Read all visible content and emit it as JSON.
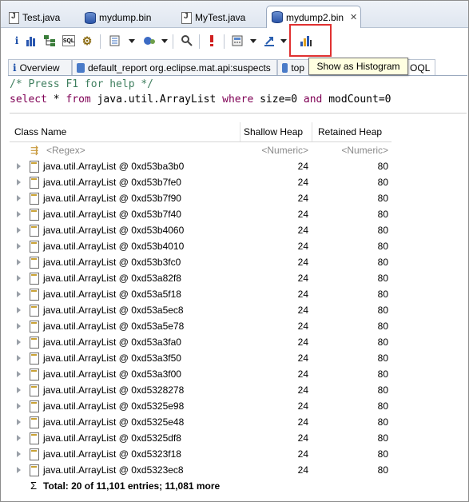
{
  "editor_tabs": [
    {
      "label": "Test.java",
      "icon": "java-file-icon",
      "active": false
    },
    {
      "label": "mydump.bin",
      "icon": "heap-dump-icon",
      "active": false
    },
    {
      "label": "MyTest.java",
      "icon": "java-file-icon",
      "active": false
    },
    {
      "label": "mydump2.bin",
      "icon": "heap-dump-icon",
      "active": true
    }
  ],
  "toolbar": {
    "icons": [
      "info-icon",
      "histogram-icon",
      "dominator-tree-icon",
      "oql-icon",
      "thread-overview-icon",
      "query-browser-icon",
      "find-object-icon",
      "search-icon",
      "run-query-icon",
      "calculate-heap-icon",
      "export-icon",
      "show-as-histogram-icon"
    ],
    "tooltip": "Show as Histogram",
    "highlight_color": "#e03030"
  },
  "sub_tabs": [
    {
      "label": "Overview",
      "icon": "info-icon"
    },
    {
      "label": "default_report  org.eclipse.mat.api:suspects",
      "icon": "report-icon"
    },
    {
      "label": "top",
      "icon": "report-icon"
    },
    {
      "label": "OQL",
      "icon": "oql-icon"
    }
  ],
  "query": {
    "comment": "/* Press F1 for help */",
    "kw_select": "select",
    "p1": " * ",
    "kw_from": "from",
    "p2": " java.util.ArrayList ",
    "kw_where": "where",
    "p3": " size=0 ",
    "kw_and": "and",
    "p4": " modCount=0"
  },
  "table": {
    "columns": [
      "Class Name",
      "Shallow Heap",
      "Retained Heap"
    ],
    "filter": {
      "name": "<Regex>",
      "shallow": "<Numeric>",
      "retained": "<Numeric>"
    },
    "rows": [
      {
        "name": "java.util.ArrayList @ 0xd53ba3b0",
        "shallow": "24",
        "retained": "80"
      },
      {
        "name": "java.util.ArrayList @ 0xd53b7fe0",
        "shallow": "24",
        "retained": "80"
      },
      {
        "name": "java.util.ArrayList @ 0xd53b7f90",
        "shallow": "24",
        "retained": "80"
      },
      {
        "name": "java.util.ArrayList @ 0xd53b7f40",
        "shallow": "24",
        "retained": "80"
      },
      {
        "name": "java.util.ArrayList @ 0xd53b4060",
        "shallow": "24",
        "retained": "80"
      },
      {
        "name": "java.util.ArrayList @ 0xd53b4010",
        "shallow": "24",
        "retained": "80"
      },
      {
        "name": "java.util.ArrayList @ 0xd53b3fc0",
        "shallow": "24",
        "retained": "80"
      },
      {
        "name": "java.util.ArrayList @ 0xd53a82f8",
        "shallow": "24",
        "retained": "80"
      },
      {
        "name": "java.util.ArrayList @ 0xd53a5f18",
        "shallow": "24",
        "retained": "80"
      },
      {
        "name": "java.util.ArrayList @ 0xd53a5ec8",
        "shallow": "24",
        "retained": "80"
      },
      {
        "name": "java.util.ArrayList @ 0xd53a5e78",
        "shallow": "24",
        "retained": "80"
      },
      {
        "name": "java.util.ArrayList @ 0xd53a3fa0",
        "shallow": "24",
        "retained": "80"
      },
      {
        "name": "java.util.ArrayList @ 0xd53a3f50",
        "shallow": "24",
        "retained": "80"
      },
      {
        "name": "java.util.ArrayList @ 0xd53a3f00",
        "shallow": "24",
        "retained": "80"
      },
      {
        "name": "java.util.ArrayList @ 0xd5328278",
        "shallow": "24",
        "retained": "80"
      },
      {
        "name": "java.util.ArrayList @ 0xd5325e98",
        "shallow": "24",
        "retained": "80"
      },
      {
        "name": "java.util.ArrayList @ 0xd5325e48",
        "shallow": "24",
        "retained": "80"
      },
      {
        "name": "java.util.ArrayList @ 0xd5325df8",
        "shallow": "24",
        "retained": "80"
      },
      {
        "name": "java.util.ArrayList @ 0xd5323f18",
        "shallow": "24",
        "retained": "80"
      },
      {
        "name": "java.util.ArrayList @ 0xd5323ec8",
        "shallow": "24",
        "retained": "80"
      }
    ],
    "total": "Total: 20 of 11,101 entries; 11,081 more"
  }
}
